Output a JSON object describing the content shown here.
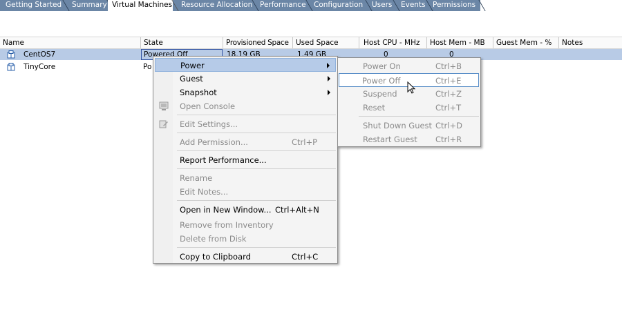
{
  "tabs": [
    {
      "label": "Getting Started",
      "active": false
    },
    {
      "label": "Summary",
      "active": false
    },
    {
      "label": "Virtual Machines",
      "active": true
    },
    {
      "label": "Resource Allocation",
      "active": false
    },
    {
      "label": "Performance",
      "active": false
    },
    {
      "label": "Configuration",
      "active": false
    },
    {
      "label": "Users",
      "active": false
    },
    {
      "label": "Events",
      "active": false
    },
    {
      "label": "Permissions",
      "active": false
    }
  ],
  "table": {
    "columns": [
      "Name",
      "State",
      "Provisioned Space",
      "Used Space",
      "Host CPU - MHz",
      "Host Mem - MB",
      "Guest Mem - %",
      "Notes"
    ],
    "rows": [
      {
        "name": "CentOS7",
        "state": "Powered Off",
        "provisioned": "18.19 GB",
        "used": "1.49 GB",
        "cpu": "0",
        "mem": "0",
        "selected": true
      },
      {
        "name": "TinyCore",
        "state": "Po",
        "selected": false
      }
    ]
  },
  "context_menu": {
    "items": [
      {
        "label": "Power",
        "shortcut": "",
        "submenu": true,
        "disabled": false,
        "highlight": true
      },
      {
        "label": "Guest",
        "shortcut": "",
        "submenu": true,
        "disabled": false
      },
      {
        "label": "Snapshot",
        "shortcut": "",
        "submenu": true,
        "disabled": false
      },
      {
        "label": "Open Console",
        "shortcut": "",
        "disabled": true,
        "icon": "console-icon"
      },
      {
        "label": "Edit Settings...",
        "shortcut": "",
        "disabled": true,
        "icon": "settings-icon"
      },
      {
        "label": "Add Permission...",
        "shortcut": "Ctrl+P",
        "disabled": true
      },
      {
        "label": "Report Performance...",
        "shortcut": "",
        "disabled": false
      },
      {
        "label": "Rename",
        "shortcut": "",
        "disabled": true
      },
      {
        "label": "Edit Notes...",
        "shortcut": "",
        "disabled": true
      },
      {
        "label": "Open in New Window...",
        "shortcut": "Ctrl+Alt+N",
        "disabled": false
      },
      {
        "label": "Remove from Inventory",
        "shortcut": "",
        "disabled": true
      },
      {
        "label": "Delete from Disk",
        "shortcut": "",
        "disabled": true
      },
      {
        "label": "Copy to Clipboard",
        "shortcut": "Ctrl+C",
        "disabled": false
      }
    ]
  },
  "power_submenu": {
    "items": [
      {
        "label": "Power On",
        "shortcut": "Ctrl+B",
        "disabled": true
      },
      {
        "label": "Power Off",
        "shortcut": "Ctrl+E",
        "disabled": true,
        "highlight": true
      },
      {
        "label": "Suspend",
        "shortcut": "Ctrl+Z",
        "disabled": true
      },
      {
        "label": "Reset",
        "shortcut": "Ctrl+T",
        "disabled": true
      },
      {
        "label": "Shut Down Guest",
        "shortcut": "Ctrl+D",
        "disabled": true
      },
      {
        "label": "Restart Guest",
        "shortcut": "Ctrl+R",
        "disabled": true
      }
    ]
  },
  "colors": {
    "tab_strip": "#6b86a6",
    "row_selected": "#b8cbe6",
    "menu_highlight": "#b6cbe8"
  }
}
